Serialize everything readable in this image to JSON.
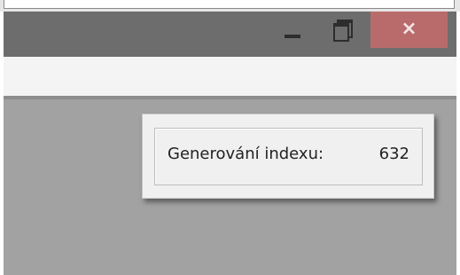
{
  "window": {
    "controls": {
      "minimize_icon": "minimize-icon",
      "maximize_icon": "restore-icon",
      "close_icon": "close-icon",
      "close_glyph": "×"
    },
    "colors": {
      "titlebar": "#6d6d6d",
      "close_button": "#b96b6b",
      "client": "#a2a2a2",
      "menubar": "#f4f4f4"
    }
  },
  "progress_dialog": {
    "label": "Generování indexu:",
    "value": "632"
  }
}
